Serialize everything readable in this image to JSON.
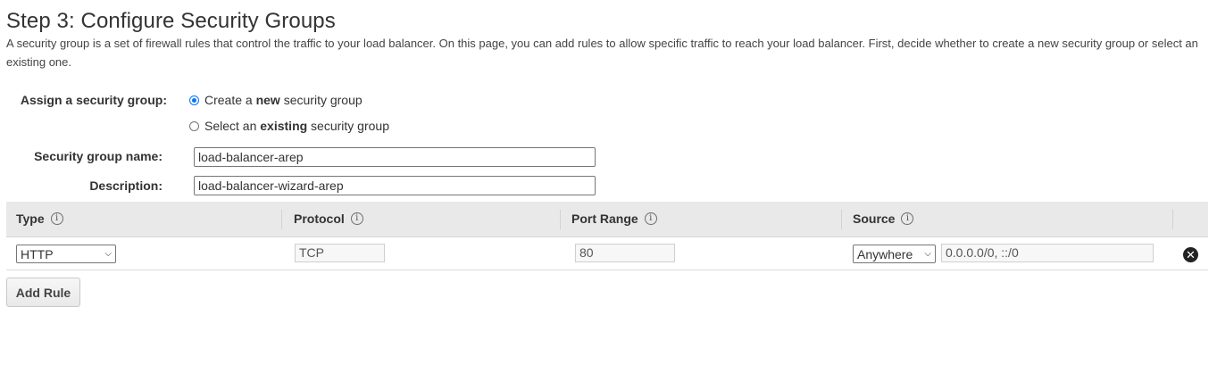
{
  "page": {
    "title": "Step 3: Configure Security Groups",
    "description": "A security group is a set of firewall rules that control the traffic to your load balancer. On this page, you can add rules to allow specific traffic to reach your load balancer. First, decide whether to create a new security group or select an existing one."
  },
  "assign": {
    "label": "Assign a security group:",
    "create_prefix": "Create a ",
    "create_bold": "new",
    "create_suffix": " security group",
    "select_prefix": "Select an ",
    "select_bold": "existing",
    "select_suffix": " security group",
    "selected": "create"
  },
  "form": {
    "name_label": "Security group name:",
    "name_value": "load-balancer-arep",
    "desc_label": "Description:",
    "desc_value": "load-balancer-wizard-arep"
  },
  "table": {
    "headers": [
      "Type",
      "Protocol",
      "Port Range",
      "Source"
    ],
    "info_glyph": "i",
    "rows": [
      {
        "type": "HTTP",
        "protocol": "TCP",
        "port_range": "80",
        "source_select": "Anywhere",
        "source_value": "0.0.0.0/0, ::/0"
      }
    ]
  },
  "actions": {
    "add_rule": "Add Rule",
    "remove_glyph": "✕"
  },
  "icons": {
    "info": "info-icon",
    "remove": "close-circle-icon",
    "dropdown": "chevron-down-icon"
  },
  "colors": {
    "radio_accent": "#0075ff",
    "header_bg": "#e9e9e9"
  }
}
